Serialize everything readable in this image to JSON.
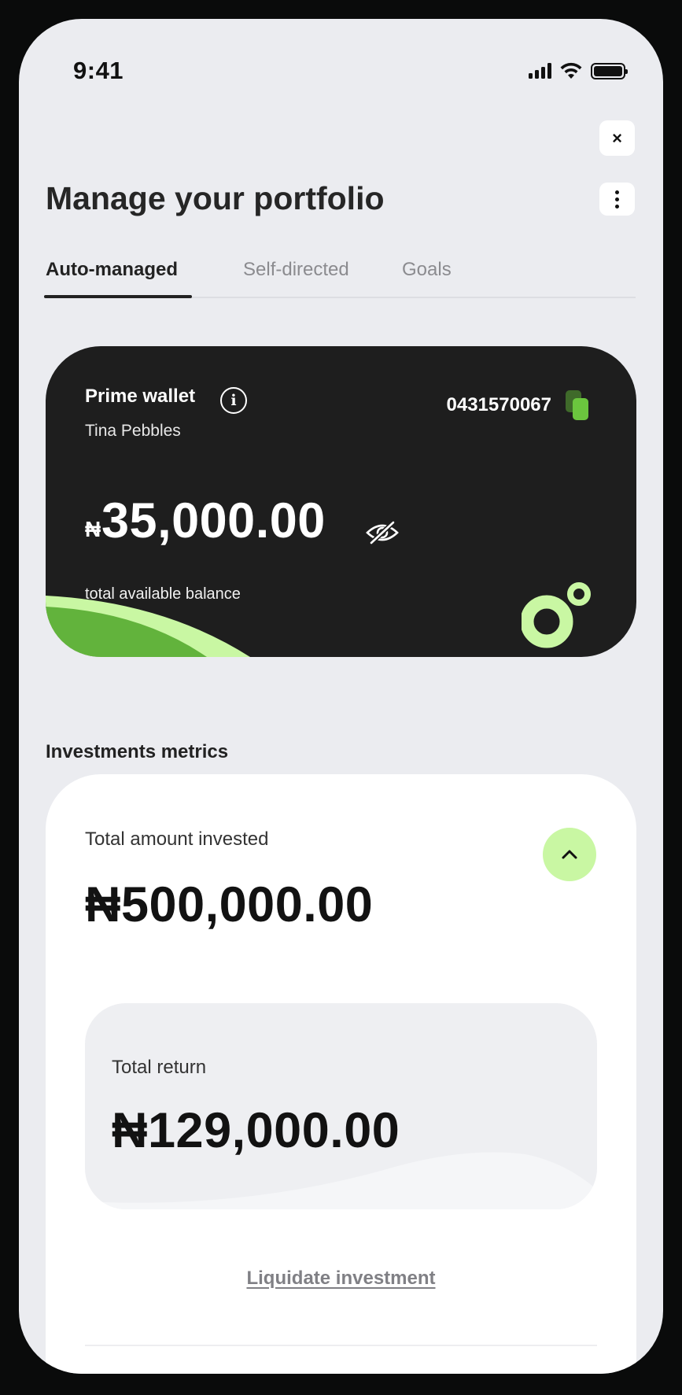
{
  "status_bar": {
    "time": "9:41"
  },
  "header": {
    "title": "Manage your portfolio"
  },
  "close_icon": {
    "glyph": "×"
  },
  "tabs": [
    {
      "label": "Auto-managed",
      "active": true
    },
    {
      "label": "Self-directed",
      "active": false
    },
    {
      "label": "Goals",
      "active": false
    }
  ],
  "wallet": {
    "title": "Prime wallet",
    "owner": "Tina Pebbles",
    "account_number": "0431570067",
    "currency_symbol": "₦",
    "balance": "35,000.00",
    "balance_label": "total available balance",
    "info_glyph": "i"
  },
  "metrics": {
    "section_title": "Investments metrics",
    "total_invested_label": "Total amount invested",
    "total_invested_value": "₦500,000.00",
    "total_return_label": "Total return",
    "total_return_value": "₦129,000.00",
    "liquidate_label": "Liquidate investment"
  },
  "colors": {
    "accent_green": "#c9f7a3",
    "brand_green": "#6bc63e",
    "card_dark": "#1e1e1e"
  }
}
